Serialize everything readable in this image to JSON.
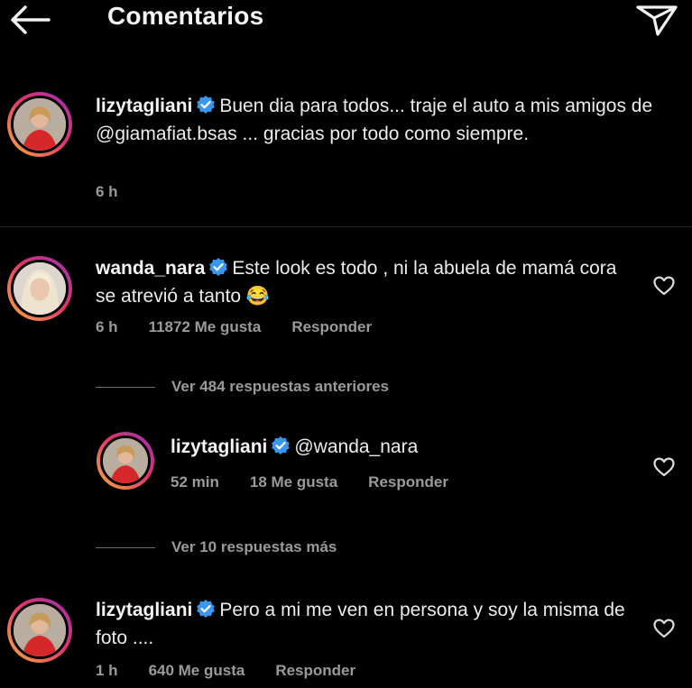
{
  "header": {
    "title": "Comentarios",
    "back_icon": "arrow-left-icon",
    "share_icon": "paper-plane-icon"
  },
  "caption": {
    "username": "lizytagliani",
    "text": "Buen dia para todos... traje el auto a mis amigos de @giamafiat.bsas ... gracias por todo como siempre.",
    "time": "6 h"
  },
  "comments": [
    {
      "username": "wanda_nara",
      "text": "Este look es todo , ni la abuela de mamá cora se atrevió a tanto 😂",
      "time": "6 h",
      "likes": "11872 Me gusta",
      "reply": "Responder",
      "view_replies": "Ver 484 respuestas anteriores",
      "replies": [
        {
          "username": "lizytagliani",
          "text": "@wanda_nara",
          "time": "52 min",
          "likes": "18 Me gusta",
          "reply": "Responder"
        }
      ],
      "view_more": "Ver 10 respuestas más"
    },
    {
      "username": "lizytagliani",
      "text": "Pero a mi me ven en persona y soy la misma de foto ....",
      "time": "1 h",
      "likes": "640 Me gusta",
      "reply": "Responder"
    }
  ],
  "colors": {
    "background": "#000000",
    "text": "#ececec",
    "muted": "#9a9a9a",
    "verified": "#3897f0"
  }
}
